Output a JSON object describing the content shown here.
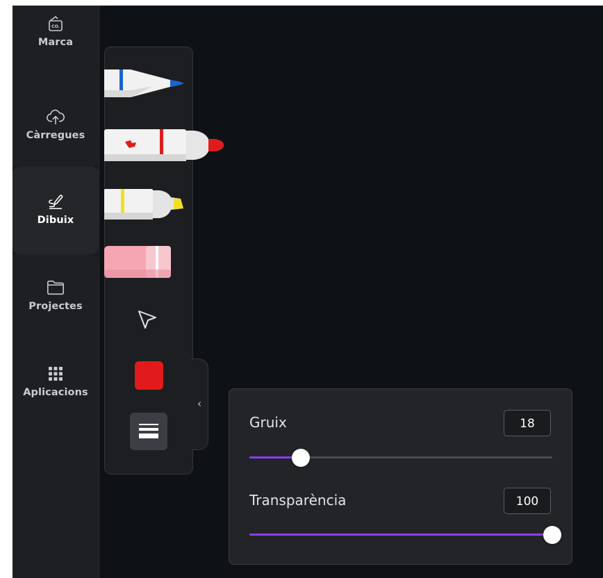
{
  "sidebar": {
    "items": [
      {
        "label": "Marca",
        "icon": "brand-kit-icon"
      },
      {
        "label": "Càrregues",
        "icon": "cloud-upload-icon"
      },
      {
        "label": "Dibuix",
        "icon": "draw-icon",
        "active": true
      },
      {
        "label": "Projectes",
        "icon": "folder-icon"
      },
      {
        "label": "Aplicacions",
        "icon": "apps-grid-icon"
      }
    ],
    "brand_icon_text": "CO."
  },
  "toolbar": {
    "tools": [
      "pen",
      "marker",
      "highlighter",
      "eraser",
      "select"
    ],
    "selected_color": "#e11b1b",
    "collapse_glyph": "‹"
  },
  "settings": {
    "thickness": {
      "label": "Gruix",
      "value": "18",
      "fraction": 0.17
    },
    "transparency": {
      "label": "Transparència",
      "value": "100",
      "fraction": 1.0
    }
  },
  "colors": {
    "accent": "#8b3dff",
    "background": "#0e1116"
  }
}
